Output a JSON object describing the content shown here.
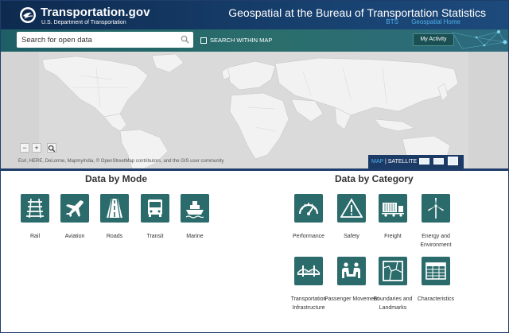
{
  "header": {
    "brand_title": "Transportation.gov",
    "brand_subtitle": "U.S. Department of Transportation",
    "site_title": "Geospatial at the Bureau of Transportation Statistics",
    "nav": {
      "bts": "BTS",
      "home": "Geospatial Home"
    }
  },
  "search": {
    "placeholder": "Search for open data",
    "within_map_label": "SEARCH WITHIN MAP",
    "my_activity": "My Activity"
  },
  "map": {
    "zoom_out": "−",
    "zoom_in": "+",
    "attribution": "Esri, HERE, DeLorme, MapmyIndia, © OpenStreetMap contributors, and the GIS user community",
    "basemap_map": "MAP",
    "basemap_sep": " | ",
    "basemap_satellite": "SATELLITE"
  },
  "data_by_mode": {
    "title": "Data by Mode",
    "items": [
      {
        "label": "Rail",
        "icon": "rail-icon"
      },
      {
        "label": "Aviation",
        "icon": "aviation-icon"
      },
      {
        "label": "Roads",
        "icon": "roads-icon"
      },
      {
        "label": "Transit",
        "icon": "transit-icon"
      },
      {
        "label": "Marine",
        "icon": "marine-icon"
      }
    ]
  },
  "data_by_category": {
    "title": "Data by Category",
    "items": [
      {
        "label": "Performance",
        "icon": "performance-icon"
      },
      {
        "label": "Safety",
        "icon": "safety-icon"
      },
      {
        "label": "Freight",
        "icon": "freight-icon"
      },
      {
        "label": "Energy and Environment",
        "icon": "energy-icon"
      },
      {
        "label": "Transportation Infrastructure",
        "icon": "infrastructure-icon"
      },
      {
        "label": "Passenger Movement",
        "icon": "passenger-icon"
      },
      {
        "label": "Boundaries and Landmarks",
        "icon": "boundaries-icon"
      },
      {
        "label": "Characteristics",
        "icon": "characteristics-icon"
      }
    ]
  },
  "colors": {
    "header_navy": "#0e2a4f",
    "search_teal": "#2b6e6c",
    "tile_teal": "#2b6b6b",
    "link_blue": "#4fb0e8",
    "map_gray": "#d6d6d6"
  }
}
